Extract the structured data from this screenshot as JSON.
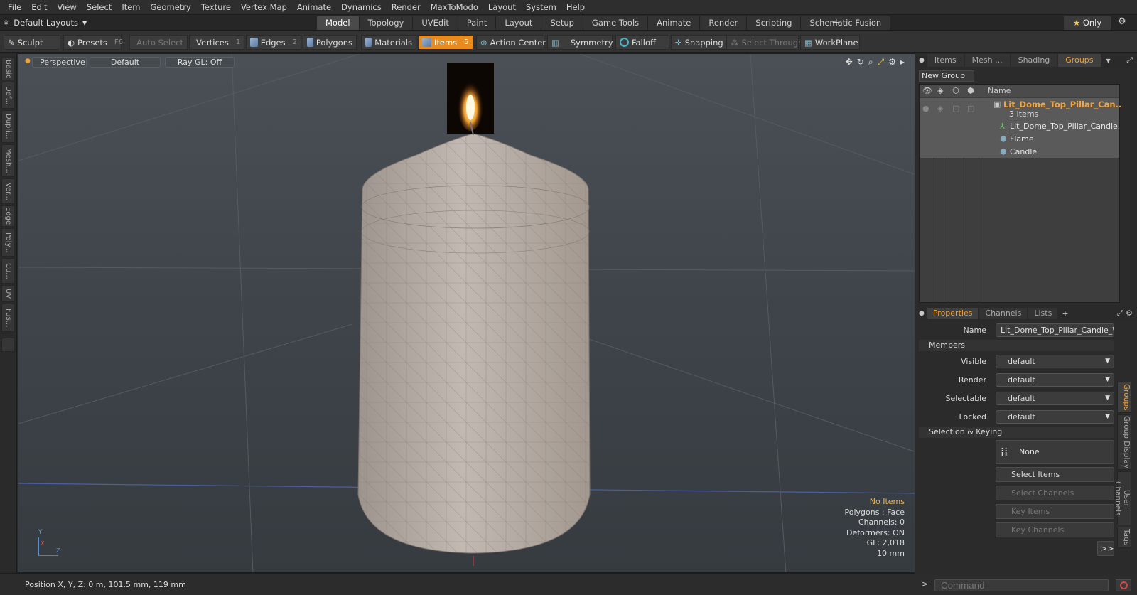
{
  "menubar": [
    "File",
    "Edit",
    "View",
    "Select",
    "Item",
    "Geometry",
    "Texture",
    "Vertex Map",
    "Animate",
    "Dynamics",
    "Render",
    "MaxToModo",
    "Layout",
    "System",
    "Help"
  ],
  "layout_selector": "Default Layouts",
  "mode_tabs": [
    {
      "label": "Model",
      "active": true
    },
    {
      "label": "Topology",
      "active": false
    },
    {
      "label": "UVEdit",
      "active": false
    },
    {
      "label": "Paint",
      "active": false
    },
    {
      "label": "Layout",
      "active": false
    },
    {
      "label": "Setup",
      "active": false
    },
    {
      "label": "Game Tools",
      "active": false
    },
    {
      "label": "Animate",
      "active": false
    },
    {
      "label": "Render",
      "active": false
    },
    {
      "label": "Scripting",
      "active": false
    },
    {
      "label": "Schematic Fusion",
      "active": false
    }
  ],
  "only_button": "Only",
  "toolbar": {
    "sculpt": "Sculpt",
    "presets": "Presets",
    "presets_key": "F6",
    "auto_select": "Auto Select",
    "vertices": "Vertices",
    "vertices_key": "1",
    "edges": "Edges",
    "edges_key": "2",
    "polygons": "Polygons",
    "materials": "Materials",
    "items": "Items",
    "items_key": "5",
    "action_center": "Action Center",
    "symmetry": "Symmetry",
    "falloff": "Falloff",
    "snapping": "Snapping",
    "select_through": "Select Through",
    "workplane": "WorkPlane"
  },
  "left_tabs": [
    "Basic",
    "Def...",
    "Dupli...",
    "Mesh...",
    "Ver...",
    "Edge",
    "Poly...",
    "Cu...",
    "UV",
    "Fus..."
  ],
  "viewport": {
    "view": "Perspective",
    "shading": "Default",
    "raygl": "Ray GL: Off",
    "info": {
      "no_items": "No Items",
      "polygons": "Polygons : Face",
      "channels": "Channels: 0",
      "deformers": "Deformers: ON",
      "gl": "GL: 2,018",
      "scale": "10 mm"
    },
    "axis_y": "Y",
    "axis_x": "X",
    "axis_z": "Z"
  },
  "status": "Position X, Y, Z:  0 m, 101.5 mm, 119 mm",
  "right_tabs": [
    {
      "label": "Items",
      "active": false
    },
    {
      "label": "Mesh ...",
      "active": false
    },
    {
      "label": "Shading",
      "active": false
    },
    {
      "label": "Groups",
      "active": true
    }
  ],
  "groups": {
    "new_group": "New Group",
    "name_header": "Name",
    "group_name": "Lit_Dome_Top_Pillar_Can...",
    "group_count": "3 Items",
    "children": [
      "Lit_Dome_Top_Pillar_Candle...",
      "Flame",
      "Candle"
    ]
  },
  "prop_tabs": [
    {
      "label": "Properties",
      "active": true
    },
    {
      "label": "Channels",
      "active": false
    },
    {
      "label": "Lists",
      "active": false
    }
  ],
  "properties": {
    "name_label": "Name",
    "name_value": "Lit_Dome_Top_Pillar_Candle_Whi",
    "members": "Members",
    "visible_label": "Visible",
    "visible_value": "default",
    "render_label": "Render",
    "render_value": "default",
    "selectable_label": "Selectable",
    "selectable_value": "default",
    "locked_label": "Locked",
    "locked_value": "default",
    "sel_keying": "Selection & Keying",
    "none": "None",
    "select_items": "Select Items",
    "select_channels": "Select Channels",
    "key_items": "Key Items",
    "key_channels": "Key Channels",
    "more": ">>"
  },
  "vertical_tabs": [
    {
      "label": "Groups",
      "active": true
    },
    {
      "label": "Group Display",
      "active": false
    },
    {
      "label": "User Channels",
      "active": false
    },
    {
      "label": "Tags",
      "active": false
    }
  ],
  "command_placeholder": "Command",
  "colors": {
    "accent": "#e88c1f",
    "group_name": "#f5a43b",
    "candle": "#bdb4ae"
  }
}
